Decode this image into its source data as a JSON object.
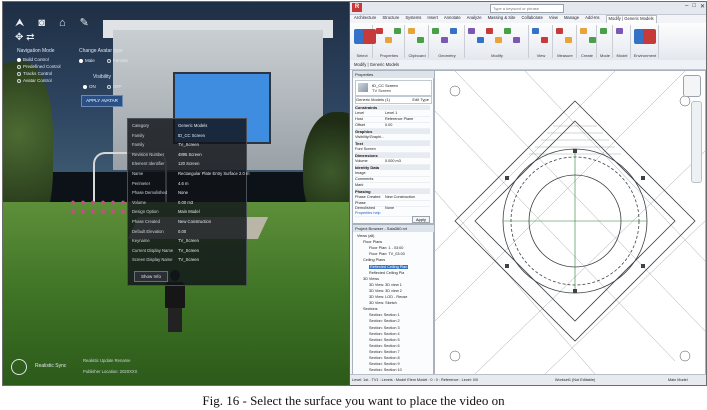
{
  "caption": "Fig. 16 - Select the surface you want to place the video on",
  "viewer": {
    "toolbar_icons": [
      "navigation-icon",
      "camera-icon",
      "home-icon",
      "wrench-icon"
    ],
    "navigation_mode": {
      "header": "Navigation Mode",
      "options": [
        "Build Control",
        "Predefined Control",
        "Tracks Control",
        "Avatar Control"
      ],
      "selected_index": 0
    },
    "change_avatar": {
      "header": "Change Avatar type",
      "options": [
        "Male",
        "Female"
      ],
      "selected_index": 0,
      "visibility_label": "Visibility",
      "visibility_options": [
        "ON",
        "OFF"
      ],
      "visibility_selected": 0,
      "apply_label": "APPLY AVATAR"
    },
    "properties": [
      {
        "k": "Category",
        "v": "Generic Models"
      },
      {
        "k": "Family",
        "v": "tD_CC Screen"
      },
      {
        "k": "Family",
        "v": "TV_Screen"
      },
      {
        "k": "Revision Number",
        "v": "4895 Screen"
      },
      {
        "k": "Element Identifier",
        "v": "120 Screen"
      },
      {
        "k": "Name",
        "v": "Rectangular Plate Entry Surface 2.0 m"
      },
      {
        "k": "Perimeter",
        "v": "4.6 m"
      },
      {
        "k": "Phase Demolished",
        "v": "None"
      },
      {
        "k": "Volume",
        "v": "0.00 m3"
      },
      {
        "k": "Design Option",
        "v": "Main Model"
      },
      {
        "k": "Phase Created",
        "v": "New Construction"
      },
      {
        "k": "Default Elevation",
        "v": "0.00"
      },
      {
        "k": "Keyname",
        "v": "TV_Screen"
      },
      {
        "k": "Current Display Name",
        "v": "TV_Screen"
      },
      {
        "k": "Screen Display Name",
        "v": "TV_Screen"
      }
    ],
    "details_label": "Show Info",
    "status": {
      "brand": "Realistic Sync",
      "line1": "Realistic Update Rename",
      "line2": "Publisher Location: 2020XXX"
    }
  },
  "revit": {
    "search_placeholder": "Type a keyword or phrase",
    "tabs": [
      "Architecture",
      "Structure",
      "Systems",
      "Insert",
      "Annotate",
      "Analyze",
      "Massing & Site",
      "Collaborate",
      "View",
      "Manage",
      "Add-Ins",
      "Modify | Generic Models"
    ],
    "active_tab_index": 11,
    "ribbon_groups": [
      "Select",
      "Properties",
      "Clipboard",
      "Geometry",
      "Modify",
      "View",
      "Measure",
      "Create",
      "Mode",
      "Model",
      "Environment"
    ],
    "options_bar": "Modify | Generic Models",
    "properties": {
      "title": "Properties",
      "type_line1": "tD_CC Screen",
      "type_line2": "TV Screen",
      "selector": "Generic Models (1)",
      "edit_type": "Edit Type",
      "sections": [
        {
          "name": "Constraints",
          "rows": [
            {
              "k": "Level",
              "v": "Level 1"
            },
            {
              "k": "Host",
              "v": "Reference Plane"
            },
            {
              "k": "Offset",
              "v": "0.00"
            }
          ]
        },
        {
          "name": "Graphics",
          "rows": [
            {
              "k": "Visibility/Graphi...",
              "v": ""
            }
          ]
        },
        {
          "name": "Text",
          "rows": [
            {
              "k": "Font Screen",
              "v": ""
            }
          ]
        },
        {
          "name": "Dimensions",
          "rows": [
            {
              "k": "Volume",
              "v": "0.000 m3"
            }
          ]
        },
        {
          "name": "Identity Data",
          "rows": [
            {
              "k": "Image",
              "v": ""
            },
            {
              "k": "Comments",
              "v": ""
            },
            {
              "k": "Mark",
              "v": ""
            }
          ]
        },
        {
          "name": "Phasing",
          "rows": [
            {
              "k": "Phase Created",
              "v": "New Construction"
            },
            {
              "k": "Phase Demolished",
              "v": "None"
            }
          ]
        }
      ],
      "help_link": "Properties help",
      "apply": "Apply"
    },
    "project_browser": {
      "title": "Project Browser - Sala360.rvt",
      "items": [
        {
          "t": "Views (all)",
          "indent": 0,
          "sel": false
        },
        {
          "t": "Floor Plans",
          "indent": 1,
          "sel": false
        },
        {
          "t": "Floor Plan: 1 - 03:00",
          "indent": 2,
          "sel": false
        },
        {
          "t": "Floor Plan: TV_03:00",
          "indent": 2,
          "sel": false
        },
        {
          "t": "Ceiling Plans",
          "indent": 1,
          "sel": false
        },
        {
          "t": "Reflected Ceiling Plan",
          "indent": 2,
          "sel": true
        },
        {
          "t": "Reflected Ceiling Pla",
          "indent": 2,
          "sel": false
        },
        {
          "t": "3D Views",
          "indent": 1,
          "sel": false
        },
        {
          "t": "3D View: 3D view 1",
          "indent": 2,
          "sel": false
        },
        {
          "t": "3D View: 3D view 2",
          "indent": 2,
          "sel": false
        },
        {
          "t": "3D View: LOD - Reuse",
          "indent": 2,
          "sel": false
        },
        {
          "t": "3D View: Sketch",
          "indent": 2,
          "sel": false
        },
        {
          "t": "Sections",
          "indent": 1,
          "sel": false
        },
        {
          "t": "Section: Section 1",
          "indent": 2,
          "sel": false
        },
        {
          "t": "Section: Section 2",
          "indent": 2,
          "sel": false
        },
        {
          "t": "Section: Section 3",
          "indent": 2,
          "sel": false
        },
        {
          "t": "Section: Section 4",
          "indent": 2,
          "sel": false
        },
        {
          "t": "Section: Section 5",
          "indent": 2,
          "sel": false
        },
        {
          "t": "Section: Section 6",
          "indent": 2,
          "sel": false
        },
        {
          "t": "Section: Section 7",
          "indent": 2,
          "sel": false
        },
        {
          "t": "Section: Section 8",
          "indent": 2,
          "sel": false
        },
        {
          "t": "Section: Section 9",
          "indent": 2,
          "sel": false
        },
        {
          "t": "Section: Section 10",
          "indent": 2,
          "sel": false
        }
      ]
    },
    "status": {
      "left": "Level: 1st - TV1 : Levels : Model Elem Model : 0 : 0 : Reference : Level: 0/0",
      "middle": "Workset1 (Not Editable)",
      "right": "Main Model"
    }
  },
  "colors": {
    "ribbon_accent": "#3472c8",
    "revit_red": "#c63a3a",
    "screen_blue": "#3f8de0"
  }
}
